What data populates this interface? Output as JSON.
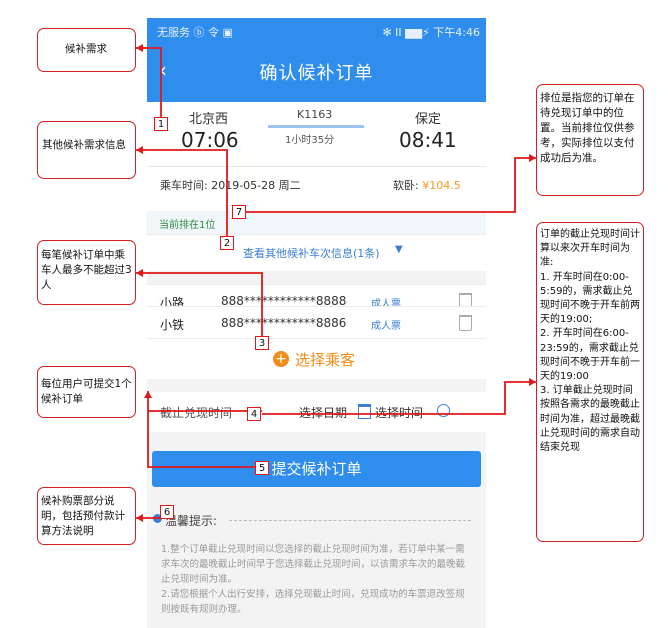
{
  "status_bar": {
    "left": "无服务 ⓑ 令 ▣",
    "right": "✻ ⅠⅠ ▆▆⚡ 下午4:46"
  },
  "nav": {
    "back_glyph": "‹",
    "title": "确认候补订单"
  },
  "train": {
    "from_station": "北京西",
    "from_time": "07:06",
    "train_no": "K1163",
    "duration": "1小时35分",
    "to_station": "保定",
    "to_time": "08:41"
  },
  "trip": {
    "date_label": "乘车时间:",
    "date_value": "2019-05-28 周二",
    "seat_label": "软卧:",
    "price": "¥104.5",
    "queue": "当前排在1位"
  },
  "more_trains": "查看其他候补车次信息(1条)",
  "passengers": [
    {
      "name": "小路",
      "id": "888************8888",
      "ticket": "成人票"
    },
    {
      "name": "小铁",
      "id": "888************8886",
      "ticket": "成人票"
    }
  ],
  "add_passenger": "选择乘客",
  "deadline": {
    "label": "截止兑现时间",
    "date_btn": "选择日期",
    "time_btn": "选择时间"
  },
  "submit": "提交候补订单",
  "tips": {
    "title": "温馨提示:",
    "body": "1.整个订单截止兑现时间以您选择的截止兑现时间为准，若订单中某一需求车次的最晚截止时间早于您选择截止兑现时间，以该需求车次的最晚截止兑现时间为准。\n2.请您根据个人出行安排，选择兑现截止时间，兑现成功的车票退改签规则按既有规则办理。"
  },
  "annotations": {
    "c1": "候补需求",
    "c2": "其他候补需求信息",
    "c3": "每笔候补订单中乘车人最多不能超过3人",
    "c4": "每位用户可提交1个候补订单",
    "c5": "候补购票部分说明，包括预付款计算方法说明",
    "c6": "排位是指您的订单在待兑现订单中的位置。当前排位仅供参考，实际排位以支付成功后为准。",
    "c7": "订单的截止兑现时间计算以来次开车时间为准:\n1. 开车时间在0:00-5:59的，需求截止兑现时间不晚于开车前两天的19:00;\n2. 开车时间在6:00-23:59的，需求截止兑现时间不晚于开车前一天的19:00\n3. 订单截止兑现时间按照各需求的最晚截止时间为准，超过最晚截止兑现时间的需求自动结束兑现",
    "n1": "1",
    "n2": "2",
    "n3": "3",
    "n4": "4",
    "n5": "5",
    "n6": "6",
    "n7": "7"
  },
  "colors": {
    "primary": "#2f8ded",
    "accent": "#f28c1b",
    "annotation_red": "#e01818"
  }
}
